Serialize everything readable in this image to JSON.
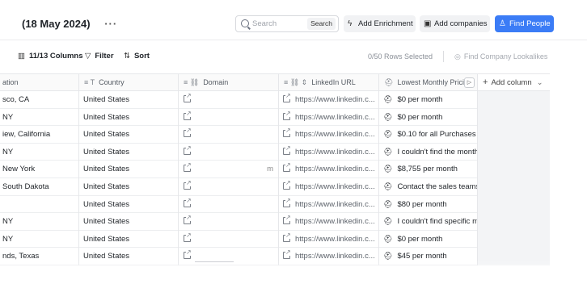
{
  "header": {
    "title": "(18 May 2024)",
    "more_glyph": "···",
    "search": {
      "placeholder": "Search",
      "button_label": "Search"
    },
    "buttons": {
      "add_enrichment": "Add Enrichment",
      "add_companies": "Add companies",
      "find_people": "Find People"
    }
  },
  "toolbar": {
    "columns": "11/13 Columns",
    "filter": "Filter",
    "sort": "Sort",
    "rows_selected": "0/50 Rows Selected",
    "lookalikes": "Find Company Lookalikes"
  },
  "table": {
    "headers": [
      "ation",
      "Country",
      "Domain",
      "LinkedIn URL",
      "Lowest Monthly Prici"
    ],
    "add_column": "Add column",
    "rows": [
      {
        "location": "sco, CA",
        "country": "United States",
        "domain_tail": "",
        "linkedin": "https://www.linkedin.c...",
        "price": "$0 per month"
      },
      {
        "location": "NY",
        "country": "United States",
        "domain_tail": "",
        "linkedin": "https://www.linkedin.c...",
        "price": "$0 per month"
      },
      {
        "location": "iew, California",
        "country": "United States",
        "domain_tail": "",
        "linkedin": "https://www.linkedin.c...",
        "price": "$0.10 for all Purchases"
      },
      {
        "location": "NY",
        "country": "United States",
        "domain_tail": "",
        "linkedin": "https://www.linkedin.c...",
        "price": "I couldn't find the month"
      },
      {
        "location": "New York",
        "country": "United States",
        "domain_tail": "m",
        "linkedin": "https://www.linkedin.c...",
        "price": "$8,755 per month"
      },
      {
        "location": "South Dakota",
        "country": "United States",
        "domain_tail": "",
        "linkedin": "https://www.linkedin.c...",
        "price": "Contact the sales teams"
      },
      {
        "location": "",
        "country": "United States",
        "domain_tail": "",
        "linkedin": "https://www.linkedin.c...",
        "price": "$80 per month"
      },
      {
        "location": "NY",
        "country": "United States",
        "domain_tail": "",
        "linkedin": "https://www.linkedin.c...",
        "price": "I couldn't find specific m"
      },
      {
        "location": "NY",
        "country": "United States",
        "domain_tail": "",
        "linkedin": "https://www.linkedin.c...",
        "price": "$0 per month"
      },
      {
        "location": "nds, Texas",
        "country": "United States",
        "domain_tail": "",
        "linkedin": "https://www.linkedin.c...",
        "price": "$45 per month"
      }
    ]
  },
  "colors": {
    "accent": "#3b7cf6",
    "grid_line": "#e6e7ea",
    "muted_text": "#8b9098"
  }
}
